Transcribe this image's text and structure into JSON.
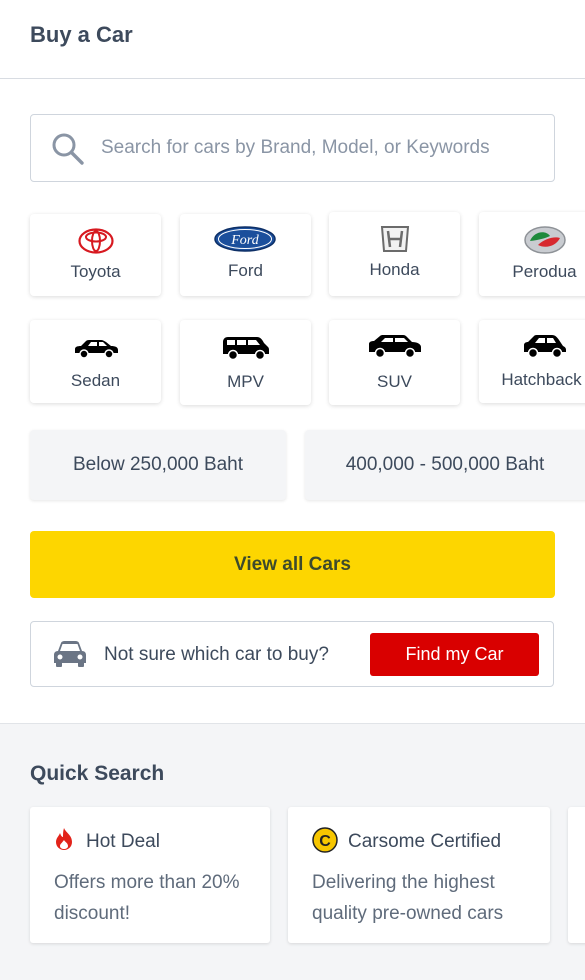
{
  "header": {
    "title": "Buy a Car"
  },
  "search": {
    "placeholder": "Search for cars by Brand, Model, or Keywords",
    "icon": "search-icon"
  },
  "brands": [
    {
      "label": "Toyota",
      "icon": "toyota-logo-icon"
    },
    {
      "label": "Ford",
      "icon": "ford-logo-icon"
    },
    {
      "label": "Honda",
      "icon": "honda-logo-icon"
    },
    {
      "label": "Perodua",
      "icon": "perodua-logo-icon"
    }
  ],
  "body_types": [
    {
      "label": "Sedan",
      "icon": "sedan-icon"
    },
    {
      "label": "MPV",
      "icon": "mpv-icon"
    },
    {
      "label": "SUV",
      "icon": "suv-icon"
    },
    {
      "label": "Hatchback",
      "icon": "hatchback-icon"
    }
  ],
  "price_ranges": [
    {
      "label": "Below 250,000 Baht"
    },
    {
      "label": "400,000 - 500,000 Baht"
    }
  ],
  "view_all": {
    "label": "View all Cars"
  },
  "not_sure": {
    "question": "Not sure which car to buy?",
    "button": "Find my Car"
  },
  "quick_search": {
    "title": "Quick Search",
    "cards": [
      {
        "title": "Hot Deal",
        "desc": "Offers more than 20% discount!",
        "icon": "fire-icon"
      },
      {
        "title": "Carsome Certified",
        "desc": "Delivering the highest quality pre-owned cars",
        "icon": "carsome-certified-icon"
      }
    ]
  },
  "colors": {
    "accent_yellow": "#fdd600",
    "accent_red": "#d90000",
    "text": "#3d4a5c"
  }
}
